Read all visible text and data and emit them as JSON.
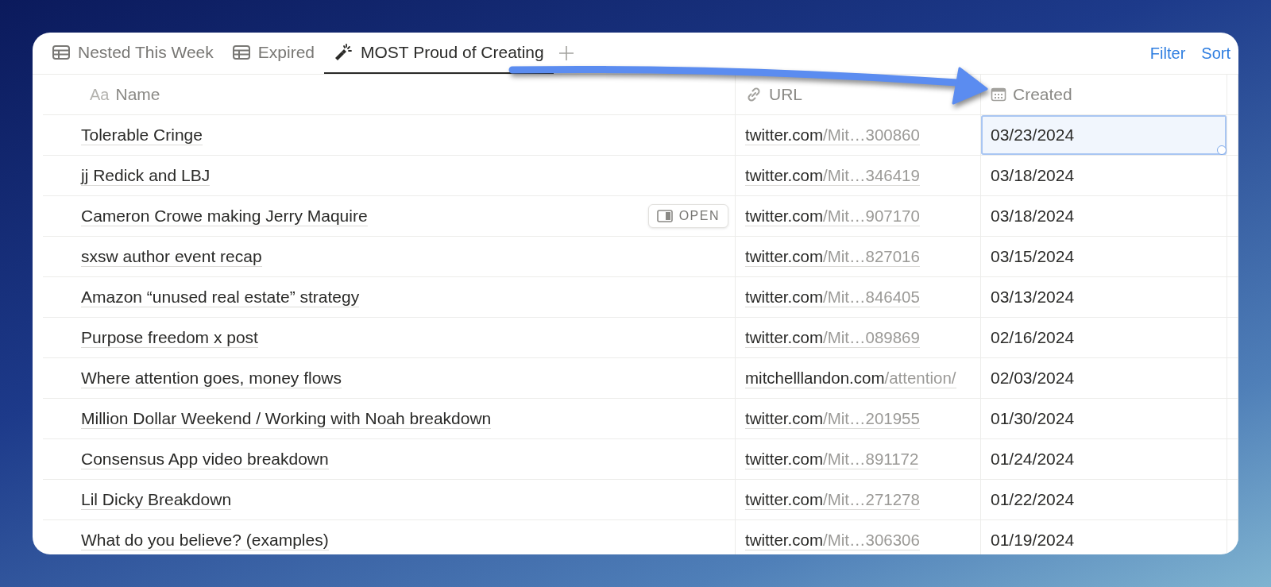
{
  "tabs": [
    {
      "label": "Nested This Week",
      "kind": "table",
      "selected": false
    },
    {
      "label": "Expired",
      "kind": "table",
      "selected": false
    },
    {
      "label": "MOST Proud of Creating",
      "kind": "flashlight",
      "selected": true
    }
  ],
  "toolbar": [
    "Filter",
    "Sort"
  ],
  "table": {
    "columns": [
      {
        "label": "Name",
        "kind": "text",
        "type_label": "Aa"
      },
      {
        "label": "URL",
        "kind": "link"
      },
      {
        "label": "Created",
        "kind": "calendar"
      }
    ],
    "rows": [
      {
        "name": "Tolerable Cringe",
        "url_host": "twitter.com",
        "url_path": "/Mit…300860",
        "created": "03/23/2024",
        "selected": true
      },
      {
        "name": "jj Redick and LBJ",
        "url_host": "twitter.com",
        "url_path": "/Mit…346419",
        "created": "03/18/2024",
        "selected": false
      },
      {
        "name": "Cameron Crowe making Jerry Maquire",
        "url_host": "twitter.com",
        "url_path": "/Mit…907170",
        "created": "03/18/2024",
        "selected": false,
        "open_button": "OPEN"
      },
      {
        "name": "sxsw author event recap",
        "url_host": "twitter.com",
        "url_path": "/Mit…827016",
        "created": "03/15/2024",
        "selected": false
      },
      {
        "name": "Amazon “unused real estate” strategy",
        "url_host": "twitter.com",
        "url_path": "/Mit…846405",
        "created": "03/13/2024",
        "selected": false
      },
      {
        "name": "Purpose freedom x post",
        "url_host": "twitter.com",
        "url_path": "/Mit…089869",
        "created": "02/16/2024",
        "selected": false
      },
      {
        "name": "Where attention goes, money flows",
        "url_host": "mitchelllandon.com",
        "url_path": "/attention/",
        "created": "02/03/2024",
        "selected": false
      },
      {
        "name": "Million Dollar Weekend / Working with Noah breakdown",
        "url_host": "twitter.com",
        "url_path": "/Mit…201955",
        "created": "01/30/2024",
        "selected": false
      },
      {
        "name": "Consensus App video breakdown",
        "url_host": "twitter.com",
        "url_path": "/Mit…891172",
        "created": "01/24/2024",
        "selected": false
      },
      {
        "name": "Lil Dicky Breakdown",
        "url_host": "twitter.com",
        "url_path": "/Mit…271278",
        "created": "01/22/2024",
        "selected": false
      },
      {
        "name": "What do you believe? (examples)",
        "url_host": "twitter.com",
        "url_path": "/Mit…306306",
        "created": "01/19/2024",
        "selected": false
      }
    ]
  }
}
